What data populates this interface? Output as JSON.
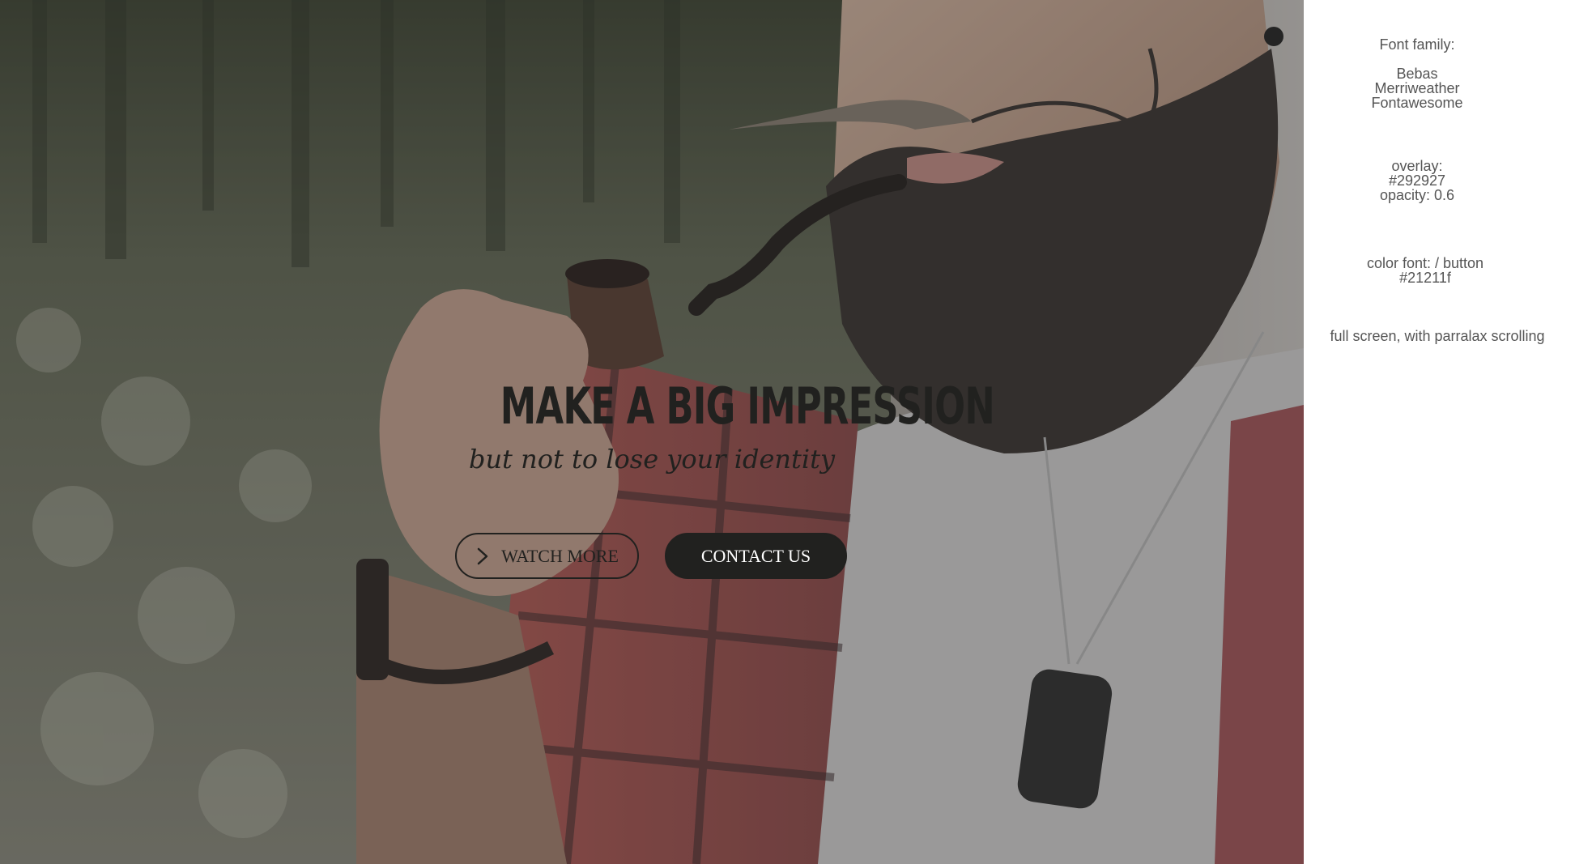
{
  "hero": {
    "title": "MAKE A BIG IMPRESSION",
    "subtitle": "but not to lose your identity",
    "watch_button": "WATCH MORE",
    "contact_button": "CONTACT US"
  },
  "notes": {
    "font_family_label": "Font family:",
    "fonts": [
      "Bebas",
      "Merriweather",
      "Fontawesome"
    ],
    "overlay_label": "overlay:",
    "overlay_color": "#292927",
    "overlay_opacity": "opacity: 0.6",
    "color_label": "color font: / button",
    "color_value": "#21211f",
    "scroll_note": "full screen, with parralax scrolling"
  },
  "colors": {
    "overlay": "#292927",
    "font": "#21211f",
    "button": "#21211f"
  },
  "icons": {
    "watch_button_icon": "chevron-right-icon"
  }
}
